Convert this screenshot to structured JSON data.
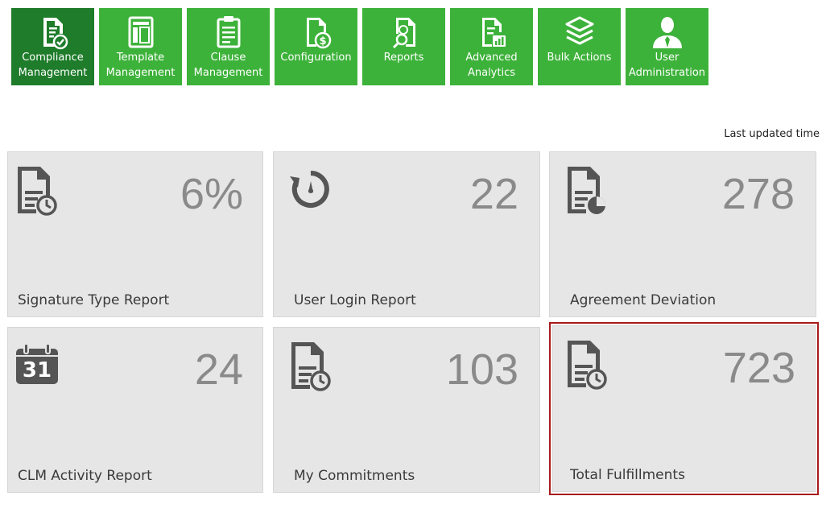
{
  "nav": [
    {
      "line1": "Compliance",
      "line2": "Management",
      "icon": "doc-check-icon",
      "active": true
    },
    {
      "line1": "Template",
      "line2": "Management",
      "icon": "template-icon",
      "active": false
    },
    {
      "line1": "Clause",
      "line2": "Management",
      "icon": "clipboard-icon",
      "active": false
    },
    {
      "line1": "Configuration",
      "line2": "",
      "icon": "doc-dollar-icon",
      "active": false
    },
    {
      "line1": "Reports",
      "line2": "",
      "icon": "doc-search-icon",
      "active": false
    },
    {
      "line1": "Advanced",
      "line2": "Analytics",
      "icon": "doc-chart-icon",
      "active": false
    },
    {
      "line1": "Bulk Actions",
      "line2": "",
      "icon": "layers-icon",
      "active": false
    },
    {
      "line1": "User",
      "line2": "Administration",
      "icon": "user-icon",
      "active": false
    }
  ],
  "last_updated": "Last updated time",
  "cards": [
    {
      "title": "Signature Type Report",
      "value": "6%",
      "icon": "doc-clock-icon"
    },
    {
      "title": "User Login Report",
      "value": "22",
      "icon": "refresh-clock-icon"
    },
    {
      "title": "Agreement Deviation",
      "value": "278",
      "icon": "doc-pie-icon"
    },
    {
      "title": "CLM Activity Report",
      "value": "24",
      "icon": "calendar-icon",
      "calendar_day": "31"
    },
    {
      "title": "My Commitments",
      "value": "103",
      "icon": "doc-clock-icon"
    },
    {
      "title": "Total Fulfillments",
      "value": "723",
      "icon": "doc-clock-icon",
      "highlighted": true
    }
  ],
  "colors": {
    "nav_green": "#3db23a",
    "nav_active": "#1e7c2a",
    "card_bg": "#e6e6e6",
    "value_gray": "#8a8a8a",
    "highlight_border": "#a81b1b"
  }
}
